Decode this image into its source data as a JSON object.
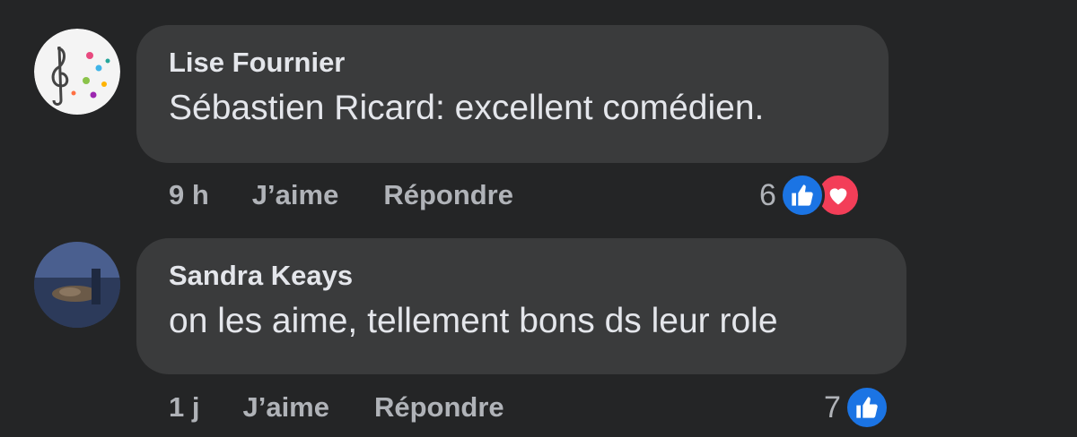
{
  "comments": [
    {
      "author": "Lise Fournier",
      "text": "Sébastien Ricard: excellent comédien.",
      "time": "9 h",
      "like_label": "J’aime",
      "reply_label": "Répondre",
      "reaction_count": "6",
      "reactions": [
        "like-icon",
        "love-icon"
      ],
      "avatar": "music-note-avatar"
    },
    {
      "author": "Sandra Keays",
      "text": "on les aime, tellement bons ds leur role",
      "time": "1 j",
      "like_label": "J’aime",
      "reply_label": "Répondre",
      "reaction_count": "7",
      "reactions": [
        "like-icon"
      ],
      "avatar": "photo-avatar"
    }
  ],
  "colors": {
    "background": "#242526",
    "bubble": "#3a3b3c",
    "text": "#e4e6eb",
    "secondary_text": "#b0b3b8",
    "like_blue": "#1b74e4",
    "love_red": "#f33e58"
  }
}
